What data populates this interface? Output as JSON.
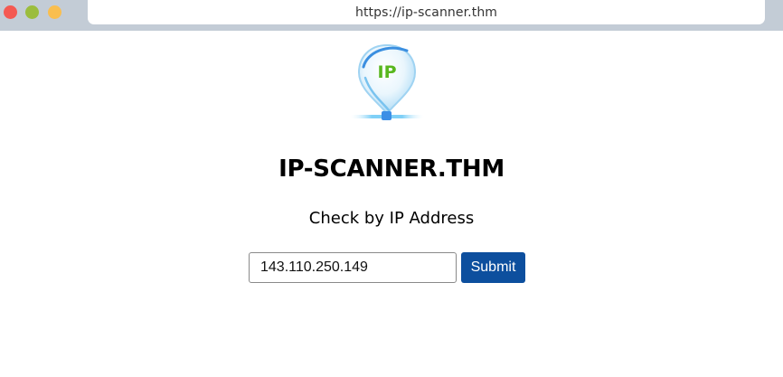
{
  "browser": {
    "url": "https://ip-scanner.thm",
    "colors": {
      "close": "#f45952",
      "minimize": "#9bbd3d",
      "maximize": "#f9be4f"
    }
  },
  "logo": {
    "icon": "ip-location-pin-icon",
    "text": "IP"
  },
  "page": {
    "title": "IP-SCANNER.THM",
    "subtitle": "Check by IP Address"
  },
  "form": {
    "ip_value": "143.110.250.149",
    "submit_label": "Submit",
    "submit_color": "#0d4f9e"
  }
}
